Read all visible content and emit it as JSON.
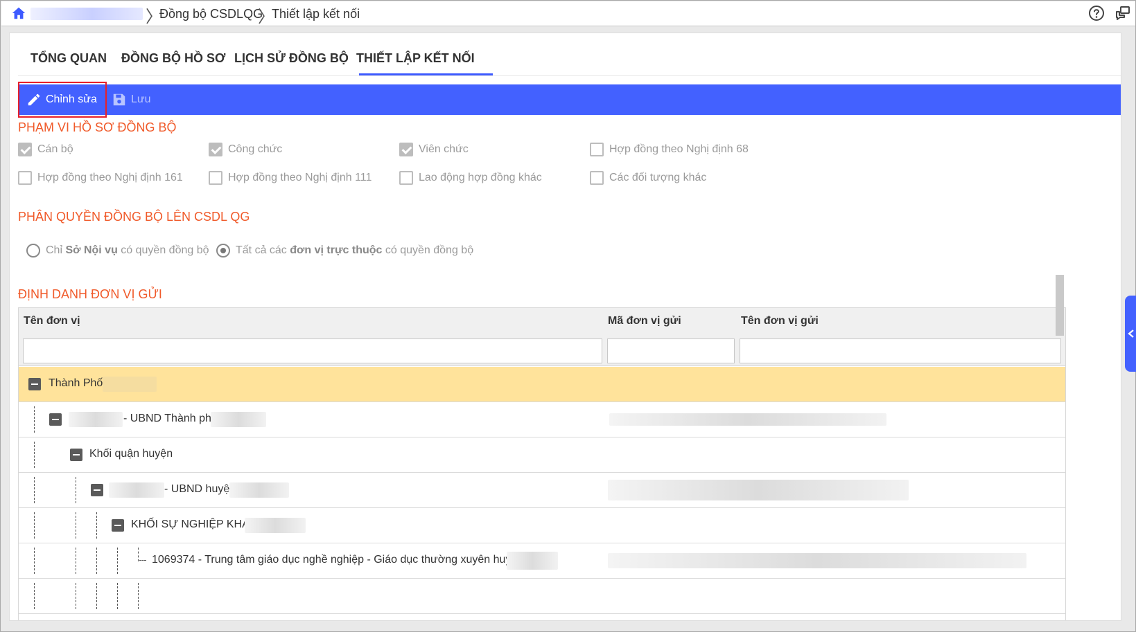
{
  "breadcrumb": {
    "items": [
      "Đồng bộ CSDLQG",
      "Thiết lập kết nối"
    ],
    "separator": "〉"
  },
  "tabs": [
    {
      "label": "TỔNG QUAN"
    },
    {
      "label": "ĐỒNG BỘ HỒ SƠ"
    },
    {
      "label": "LỊCH SỬ ĐỒNG BỘ"
    },
    {
      "label": "THIẾT LẬP KẾT NỐI",
      "active": true
    }
  ],
  "toolbar": {
    "edit_label": "Chỉnh sửa",
    "save_label": "Lưu"
  },
  "scope": {
    "title": "PHẠM VI HỒ SƠ ĐỒNG BỘ",
    "options": [
      {
        "label": "Cán bộ",
        "checked": true
      },
      {
        "label": "Công chức",
        "checked": true
      },
      {
        "label": "Viên chức",
        "checked": true
      },
      {
        "label": "Hợp đồng theo Nghị định 68",
        "checked": false
      },
      {
        "label": "Hợp đồng theo Nghị định 161",
        "checked": false
      },
      {
        "label": "Hợp đồng theo Nghị định 111",
        "checked": false
      },
      {
        "label": "Lao động hợp đồng khác",
        "checked": false
      },
      {
        "label": "Các đối tượng khác",
        "checked": false
      }
    ]
  },
  "permission": {
    "title": "PHÂN QUYỀN ĐỒNG BỘ LÊN CSDL QG",
    "options": [
      {
        "prefix": "Chỉ ",
        "bold": "Sở Nội vụ",
        "suffix": " có quyền đồng bộ",
        "selected": false
      },
      {
        "prefix": "Tất cả các ",
        "bold": "đơn vị trực thuộc",
        "suffix": " có quyền đồng bộ",
        "selected": true
      }
    ]
  },
  "sender": {
    "title": "ĐỊNH DANH ĐƠN VỊ GỬI",
    "columns": [
      "Tên đơn vị",
      "Mã đơn vị gửi",
      "Tên đơn vị gửi"
    ],
    "rows": [
      {
        "label": "Thành Phố"
      },
      {
        "label": "- UBND Thành phố"
      },
      {
        "label": "Khối quận huyện"
      },
      {
        "label": "- UBND huyện"
      },
      {
        "label": "KHỐI SỰ NGHIỆP KHÁC"
      },
      {
        "label": "1069374 - Trung tâm giáo dục nghề nghiệp - Giáo dục thường xuyên huyện"
      }
    ]
  },
  "colors": {
    "accent": "#4361ff",
    "section_title": "#f05a2a",
    "selected_row": "#ffe39b",
    "edit_outline": "#e8202a"
  }
}
